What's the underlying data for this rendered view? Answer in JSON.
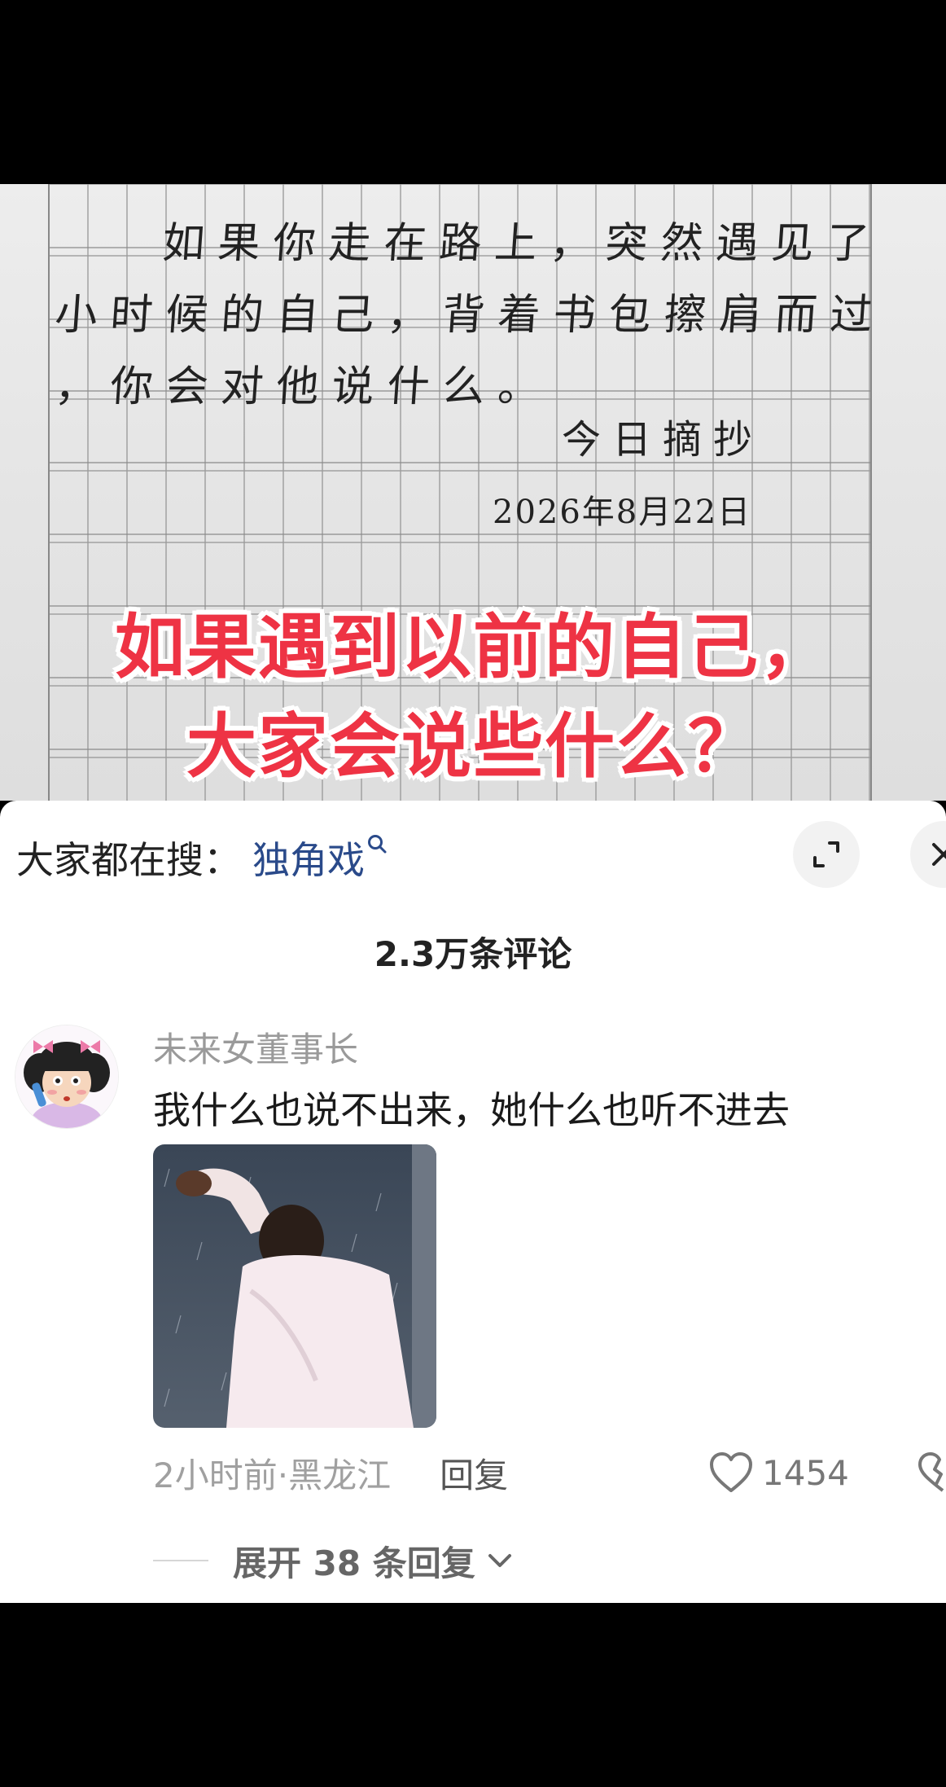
{
  "post": {
    "handwriting_lines": [
      "如果你走在路上，突然遇见了",
      "小时候的自己，背着书包擦肩而过",
      "，你会对他说什么。"
    ],
    "handwriting_signature": "今日摘抄",
    "handwriting_date": "2026年8月22日",
    "caption_line1": "如果遇到以前的自己，",
    "caption_line2": "大家会说些什么？"
  },
  "search_bar": {
    "label": "大家都在搜：",
    "term": "独角戏",
    "term_icon": "search-icon"
  },
  "controls": {
    "expand_icon": "expand-icon",
    "close_icon": "close-icon"
  },
  "comments_header": {
    "count_label": "2.3万条评论"
  },
  "comment": {
    "username": "未来女董事长",
    "text": "我什么也说不出来，她什么也听不进去",
    "time_location": "2小时前·黑龙江",
    "reply_label": "回复",
    "like_count": "1454",
    "expand_replies": "展开 38 条回复",
    "colors": {
      "accent_red": "#ee3344",
      "link_blue": "#2a4a8a"
    }
  }
}
